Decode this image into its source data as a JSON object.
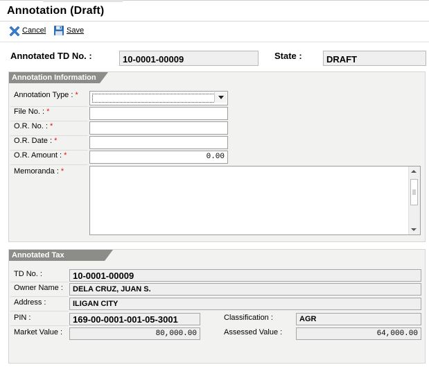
{
  "window": {
    "title": "Annotation (Draft)"
  },
  "toolbar": {
    "cancel_label": "Cancel",
    "save_label": "Save"
  },
  "header": {
    "td_label": "Annotated TD No. :",
    "td_value": "10-0001-00009",
    "state_label": "State :",
    "state_value": "DRAFT"
  },
  "annotation_info": {
    "section_title": "Annotation Information",
    "type_label": "Annotation Type :",
    "type_value": "",
    "file_label": "File No. :",
    "file_value": "",
    "or_no_label": "O.R. No. :",
    "or_no_value": "",
    "or_date_label": "O.R. Date :",
    "or_date_value": "",
    "or_amount_label": "O.R. Amount :",
    "or_amount_value": "0.00",
    "memoranda_label": "Memoranda :",
    "memoranda_value": "",
    "required_mark": "*"
  },
  "tax_declaration": {
    "section_title": "Annotated Tax Declaration",
    "td_label": "TD No. :",
    "td_value": "10-0001-00009",
    "owner_label": "Owner Name :",
    "owner_value": "DELA CRUZ, JUAN S.",
    "address_label": "Address :",
    "address_value": "ILIGAN CITY",
    "pin_label": "PIN :",
    "pin_value": "169-00-0001-001-05-3001",
    "classification_label": "Classification :",
    "classification_value": "AGR",
    "market_label": "Market Value :",
    "market_value": "80,000.00",
    "assessed_label": "Assessed Value :",
    "assessed_value": "64,000.00"
  },
  "icons": {
    "cancel": "x-cross-icon",
    "save": "floppy-disk-icon"
  },
  "colors": {
    "required": "#e01010",
    "section_tab": "#8c8c88",
    "panel_bg": "#f2f2f0",
    "cancel_icon": "#3a7fd0",
    "save_icon": "#2f6fb8"
  }
}
